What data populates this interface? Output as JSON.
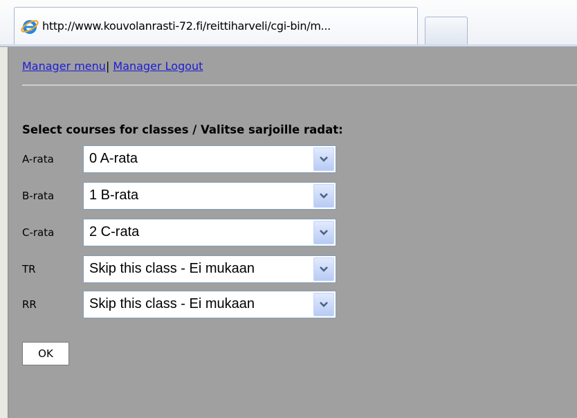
{
  "browser": {
    "tab_title": "http://www.kouvolanrasti-72.fi/reittiharveli/cgi-bin/m..."
  },
  "nav": {
    "manager_menu": "Manager menu",
    "separator": "|",
    "manager_logout": "Manager Logout"
  },
  "form": {
    "heading": "Select courses for classes / Valitse sarjoille radat:",
    "rows": [
      {
        "label": "A-rata",
        "selected": "0 A-rata"
      },
      {
        "label": "B-rata",
        "selected": "1 B-rata"
      },
      {
        "label": "C-rata",
        "selected": "2 C-rata"
      },
      {
        "label": "TR",
        "selected": "Skip this class - Ei mukaan"
      },
      {
        "label": "RR",
        "selected": "Skip this class - Ei mukaan"
      }
    ],
    "ok_label": "OK"
  },
  "icons": {
    "tab_icon": "internet-explorer-icon",
    "dropdown_arrow": "chevron-down-icon"
  },
  "colors": {
    "page_background": "#a0a0a0",
    "link": "#1c1cd6"
  }
}
